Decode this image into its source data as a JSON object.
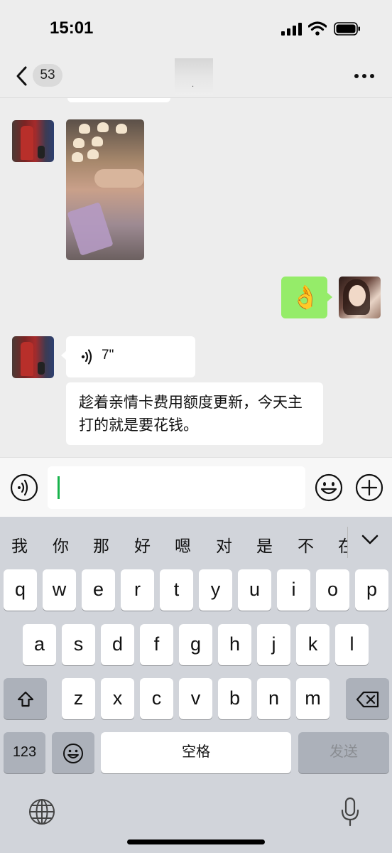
{
  "status_bar": {
    "time": "15:01"
  },
  "nav": {
    "unread_count": "53",
    "title": "."
  },
  "messages": {
    "voice": {
      "duration": "7\""
    },
    "text": "趁着亲情卡费用额度更新，今天主打的就是要花钱。",
    "emoji": "👌"
  },
  "candidates": [
    "我",
    "你",
    "那",
    "好",
    "嗯",
    "对",
    "是",
    "不",
    "在"
  ],
  "keyboard": {
    "row1": [
      "q",
      "w",
      "e",
      "r",
      "t",
      "y",
      "u",
      "i",
      "o",
      "p"
    ],
    "row2": [
      "a",
      "s",
      "d",
      "f",
      "g",
      "h",
      "j",
      "k",
      "l"
    ],
    "row3": [
      "z",
      "x",
      "c",
      "v",
      "b",
      "n",
      "m"
    ],
    "numbers_label": "123",
    "space_label": "空格",
    "send_label": "发送"
  },
  "icons": {
    "back": "chevron-left-icon",
    "more": "ellipsis-icon",
    "voice_toggle": "voice-icon",
    "emoji": "smiley-icon",
    "plus": "plus-icon",
    "shift": "shift-icon",
    "delete": "backspace-icon",
    "emoji_key": "emoji-icon",
    "globe": "globe-icon",
    "mic": "microphone-icon"
  },
  "colors": {
    "sent_bubble": "#95ec69",
    "background": "#ededed",
    "caret": "#18b34c"
  }
}
